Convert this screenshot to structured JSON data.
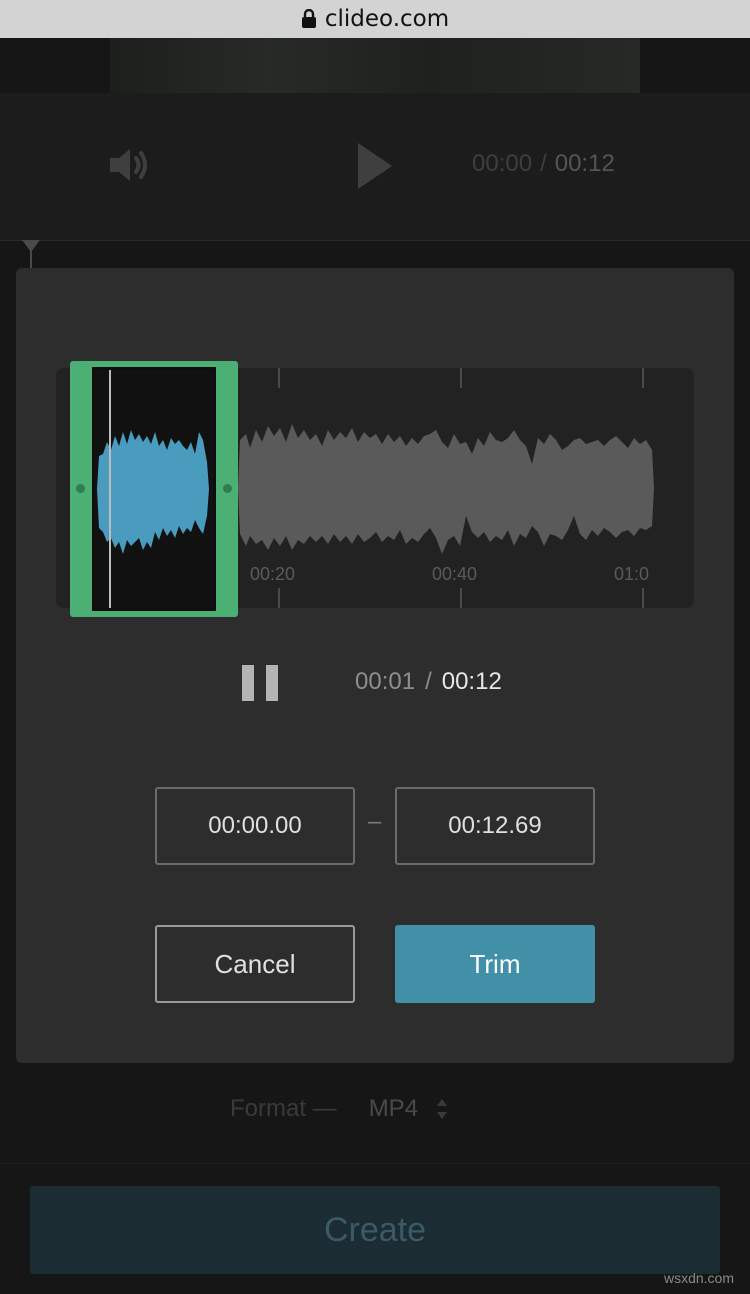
{
  "browser": {
    "host": "clideo.com",
    "lock_icon": "lock-icon"
  },
  "player": {
    "current_time": "00:00",
    "separator": "/",
    "total_time": "00:12",
    "volume_icon": "volume-icon",
    "play_icon": "play-icon"
  },
  "trim_modal": {
    "timeline_ticks": [
      "00:20",
      "00:40",
      "01:0"
    ],
    "playback": {
      "pause_icon": "pause-icon",
      "current_time": "00:01",
      "separator": "/",
      "total_time": "00:12"
    },
    "start_time": "00:00.00",
    "range_separator": "–",
    "end_time": "00:12.69",
    "cancel_label": "Cancel",
    "trim_label": "Trim"
  },
  "format": {
    "label": "Format —",
    "value": "MP4"
  },
  "create_label": "Create",
  "watermark": "wsxdn.com",
  "colors": {
    "selection": "#4caf73",
    "accent": "#4290a8",
    "waveform_selected": "#4a9cbf",
    "waveform": "#5a5a5a"
  }
}
